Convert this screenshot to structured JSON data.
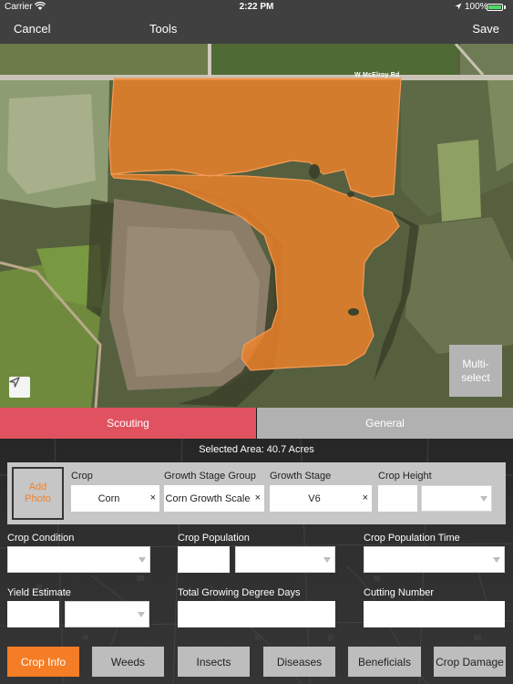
{
  "status_bar": {
    "carrier": "Carrier",
    "time": "2:22 PM",
    "battery_pct": "100%"
  },
  "nav": {
    "cancel": "Cancel",
    "tools": "Tools",
    "save": "Save"
  },
  "map": {
    "road_label": "W McElroy Rd",
    "multi_select": "Multi-\nselect",
    "field_color": "#f0822a"
  },
  "tabs": {
    "scouting": "Scouting",
    "general": "General",
    "active": "Scouting"
  },
  "panel": {
    "selected_area": "Selected Area: 40.7 Acres",
    "add_photo": "Add\nPhoto",
    "crop": {
      "label": "Crop",
      "value": "Corn"
    },
    "growth_stage_group": {
      "label": "Growth Stage Group",
      "value": "Corn Growth Scale"
    },
    "growth_stage": {
      "label": "Growth Stage",
      "value": "V6"
    },
    "crop_height": {
      "label": "Crop Height",
      "value": "",
      "unit": ""
    },
    "crop_condition": {
      "label": "Crop Condition",
      "value": ""
    },
    "crop_population": {
      "label": "Crop Population",
      "value": "",
      "unit": ""
    },
    "crop_population_time": {
      "label": "Crop Population Time",
      "value": ""
    },
    "yield_estimate": {
      "label": "Yield Estimate",
      "value": "",
      "unit": ""
    },
    "total_gdd": {
      "label": "Total Growing Degree Days",
      "value": ""
    },
    "cutting_number": {
      "label": "Cutting Number",
      "value": ""
    },
    "clear_glyph": "×"
  },
  "bottom_tabs": [
    {
      "label": "Crop Info",
      "active": true
    },
    {
      "label": "Weeds",
      "active": false
    },
    {
      "label": "Insects",
      "active": false
    },
    {
      "label": "Diseases",
      "active": false
    },
    {
      "label": "Beneficials",
      "active": false
    },
    {
      "label": "Crop Damage",
      "active": false
    }
  ],
  "colors": {
    "accent_orange": "#f47d25",
    "scouting_red": "#e05260",
    "tab_gray": "#b1b1b1",
    "bar_dark": "#404040"
  },
  "icons": {
    "location_arrow": "location-arrow-icon",
    "wifi": "wifi-icon",
    "battery": "battery-icon"
  }
}
